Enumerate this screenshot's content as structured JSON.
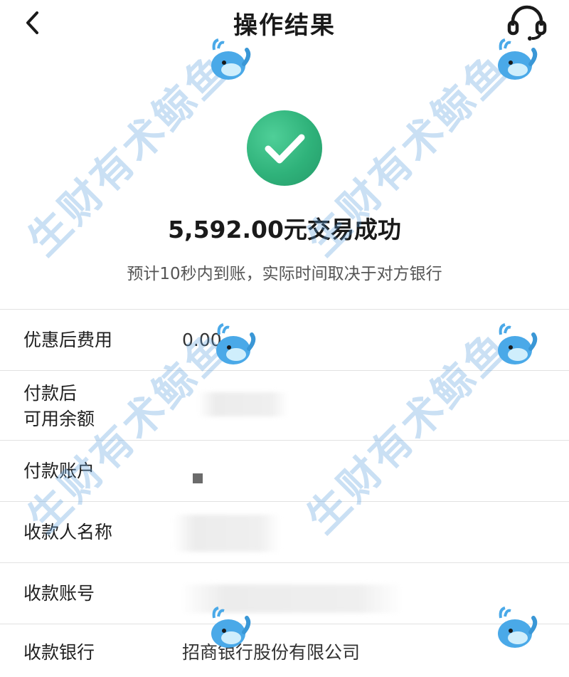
{
  "header": {
    "title": "操作结果",
    "back_icon": "chevron-left-icon",
    "support_icon": "headset-icon"
  },
  "result": {
    "status_icon": "check-circle-icon",
    "amount_text": "5,592.00元交易成功",
    "note": "预计10秒内到账，实际时间取决于对方银行",
    "accent_color": "#2fb27a"
  },
  "details": [
    {
      "label": "优惠后费用",
      "value": "0.00"
    },
    {
      "label_line1": "付款后",
      "label_line2": "可用余额",
      "value": ""
    },
    {
      "label": "付款账户",
      "value": ""
    },
    {
      "label": "收款人名称",
      "value": ""
    },
    {
      "label": "收款账号",
      "value": ""
    },
    {
      "label": "收款银行",
      "value": "招商银行股份有限公司"
    }
  ],
  "watermark": {
    "text": "生财有术鲸鱼",
    "mascot_icon": "whale-mascot-icon"
  }
}
